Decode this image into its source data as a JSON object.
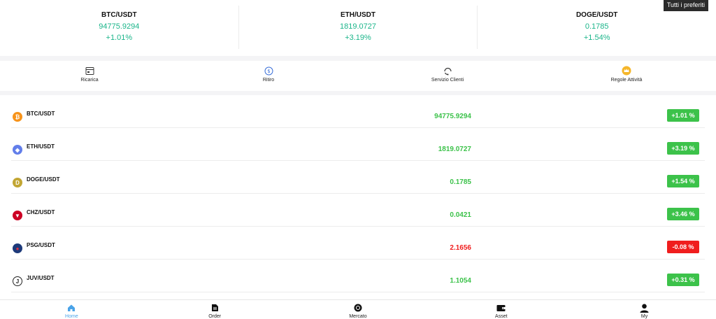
{
  "favorites_label": "Tutti i preferiti",
  "ticker": [
    {
      "pair": "BTC/USDT",
      "price": "94775.9294",
      "change": "+1.01%"
    },
    {
      "pair": "ETH/USDT",
      "price": "1819.0727",
      "change": "+3.19%"
    },
    {
      "pair": "DOGE/USDT",
      "price": "0.1785",
      "change": "+1.54%"
    }
  ],
  "actions": [
    {
      "label": "Ricarica",
      "icon": "deposit-card-icon"
    },
    {
      "label": "Ritiro",
      "icon": "withdraw-coin-icon"
    },
    {
      "label": "Servizio Clienti",
      "icon": "customer-service-icon"
    },
    {
      "label": "Regole Attività",
      "icon": "crown-icon"
    }
  ],
  "market": [
    {
      "pair": "BTC/USDT",
      "price": "94775.9294",
      "change": "+1.01 %",
      "trend": "up",
      "icon_color": "#f7931a",
      "icon_glyph": "₿"
    },
    {
      "pair": "ETH/USDT",
      "price": "1819.0727",
      "change": "+3.19 %",
      "trend": "up",
      "icon_color": "#627eea",
      "icon_glyph": "◆"
    },
    {
      "pair": "DOGE/USDT",
      "price": "0.1785",
      "change": "+1.54 %",
      "trend": "up",
      "icon_color": "#c2a633",
      "icon_glyph": "D"
    },
    {
      "pair": "CHZ/USDT",
      "price": "0.0421",
      "change": "+3.46 %",
      "trend": "up",
      "icon_color": "#cd0124",
      "icon_glyph": "▼"
    },
    {
      "pair": "PSG/USDT",
      "price": "2.1656",
      "change": "-0.08 %",
      "trend": "down",
      "icon_color": "#1d3a7a",
      "icon_glyph": "●"
    },
    {
      "pair": "JUV/USDT",
      "price": "1.1054",
      "change": "+0.31 %",
      "trend": "up",
      "icon_color": "#ffffff",
      "icon_glyph": "J"
    }
  ],
  "nav": [
    {
      "label": "Home",
      "icon": "home-icon",
      "active": true
    },
    {
      "label": "Order",
      "icon": "order-document-icon",
      "active": false
    },
    {
      "label": "Mercato",
      "icon": "market-disc-icon",
      "active": false
    },
    {
      "label": "Asset",
      "icon": "wallet-icon",
      "active": false
    },
    {
      "label": "My",
      "icon": "user-icon",
      "active": false
    }
  ],
  "colors": {
    "up": "#3cc24a",
    "down": "#f01d1d",
    "ticker_green": "#1bb58a",
    "active_nav": "#4aa3e8"
  }
}
